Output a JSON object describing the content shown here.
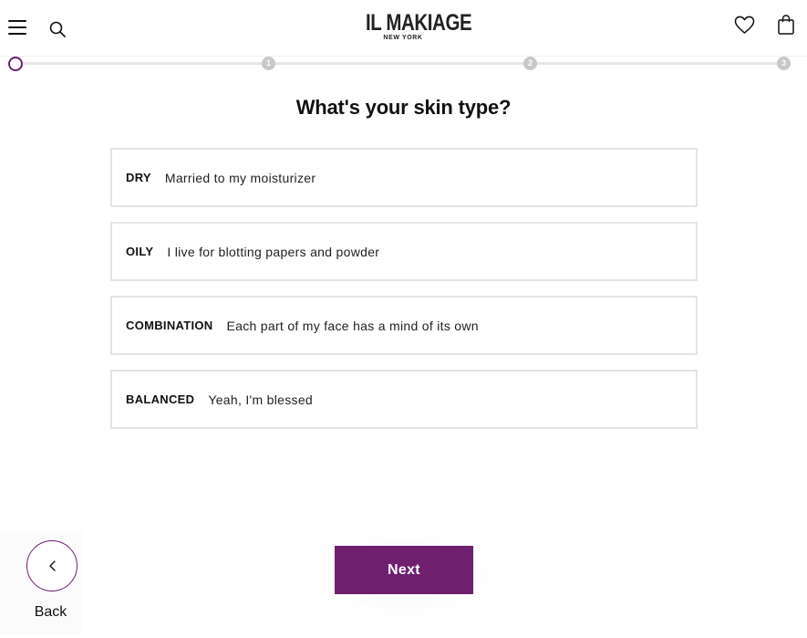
{
  "header": {
    "logo_main": "IL MAKIAGE",
    "logo_sub": "NEW YORK",
    "icons": [
      "menu-icon",
      "search-icon",
      "heart-icon",
      "shopping-bag-icon"
    ]
  },
  "progress": {
    "steps": [
      "1",
      "2",
      "3"
    ],
    "current_step": 0,
    "accent_color": "#6e1f6e",
    "inactive_color": "#c8c8c8"
  },
  "quiz": {
    "title": "What's your skin type?",
    "options": [
      {
        "key": "DRY",
        "description": "Married to my moisturizer"
      },
      {
        "key": "OILY",
        "description": "I live for blotting papers and powder"
      },
      {
        "key": "COMBINATION",
        "description": "Each part of my face has a mind of its own"
      },
      {
        "key": "BALANCED",
        "description": "Yeah, I'm blessed"
      }
    ]
  },
  "nav": {
    "back_label": "Back",
    "next_label": "Next",
    "next_color": "#6e1f6e"
  }
}
